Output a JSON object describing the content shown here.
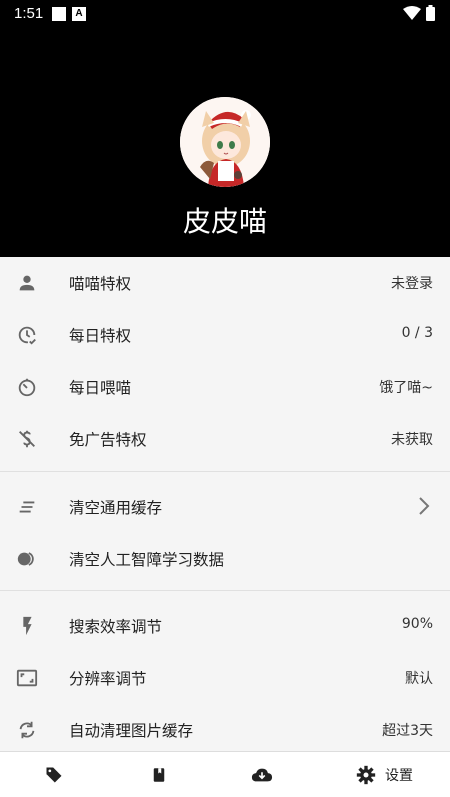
{
  "statusbar": {
    "time": "1:51",
    "notif_letter": "A"
  },
  "profile": {
    "name": "皮皮喵"
  },
  "menu": {
    "items": [
      {
        "label": "喵喵特权",
        "value": "未登录",
        "icon": "person-icon"
      },
      {
        "label": "每日特权",
        "value": "0 / 3",
        "icon": "clock-check-icon"
      },
      {
        "label": "每日喂喵",
        "value": "饿了喵~",
        "icon": "timer-icon"
      },
      {
        "label": "免广告特权",
        "value": "未获取",
        "icon": "money-off-icon"
      },
      {
        "label": "清空通用缓存",
        "value": "",
        "icon": "clear-all-icon"
      },
      {
        "label": "清空人工智障学习数据",
        "value": "",
        "icon": "toggle-icon"
      },
      {
        "label": "搜索效率调节",
        "value": "90%",
        "icon": "flash-icon"
      },
      {
        "label": "分辨率调节",
        "value": "默认",
        "icon": "aspect-ratio-icon"
      },
      {
        "label": "自动清理图片缓存",
        "value": "超过3天",
        "icon": "sync-icon"
      }
    ]
  },
  "bottomnav": {
    "settings_label": "设置"
  },
  "colors": {
    "header_bg": "#000000",
    "list_bg": "#f5f5f5",
    "icon_gray": "#666666"
  }
}
